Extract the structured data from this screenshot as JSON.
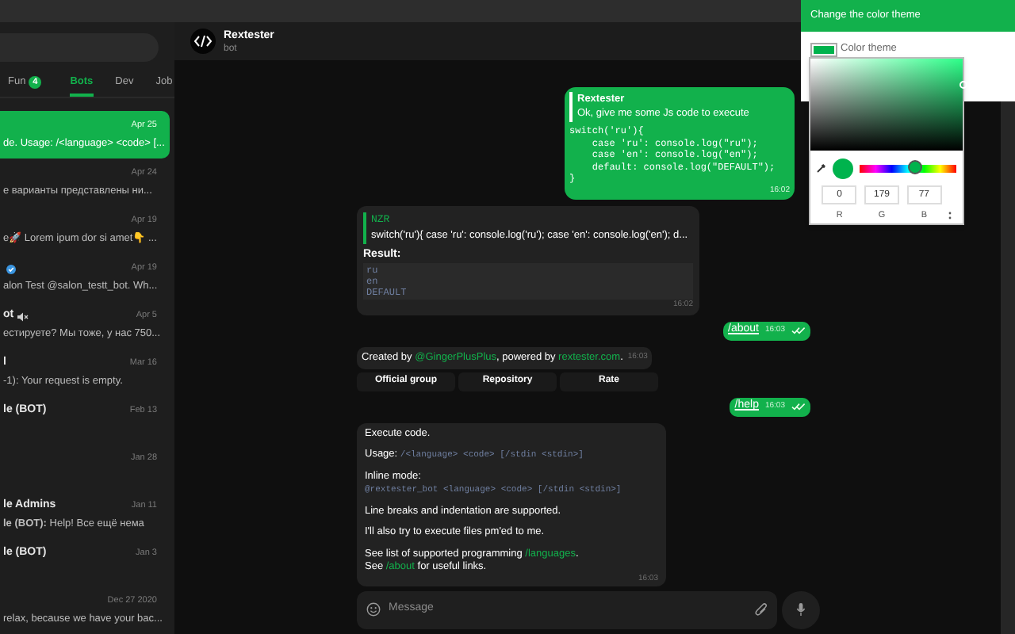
{
  "folders": [
    {
      "label": "Fun",
      "badge": "4",
      "selected": false
    },
    {
      "label": "Bots",
      "selected": true
    },
    {
      "label": "Dev",
      "selected": false
    },
    {
      "label": "Job",
      "selected": false
    }
  ],
  "chats": [
    {
      "date": "Apr 25",
      "preview": "de. Usage: /<language> <code> [...",
      "selected": true
    },
    {
      "date": "Apr 24",
      "preview": "е варианты представлены ни...",
      "selected": false
    },
    {
      "date": "Apr 19",
      "preview": "e🚀 Lorem ipum dor si amet👇 ...",
      "selected": false
    },
    {
      "verified": true,
      "date": "Apr 19",
      "preview": "alon Test @salon_testt_bot. Wh...",
      "selected": false
    },
    {
      "name": "ot",
      "muted": true,
      "date": "Apr 5",
      "preview": "естируете? Мы тоже, у нас 750...",
      "selected": false
    },
    {
      "name": "l",
      "date": "Mar 16",
      "preview": "-1): Your request is empty.",
      "selected": false
    },
    {
      "name": "le (BOT)",
      "date": "Feb 13",
      "selected": false
    },
    {
      "date": "Jan 28",
      "selected": false
    },
    {
      "name": "le Admins",
      "date": "Jan 11",
      "preview": "**le (BOT):** Help! Все ещё нема",
      "selected": false
    },
    {
      "name": "le (BOT)",
      "date": "Jan 3",
      "selected": false
    },
    {
      "date": "Dec 27 2020",
      "preview": "relax, because we have your bac...",
      "selected": false
    }
  ],
  "chat": {
    "title": "Rextester",
    "subtitle": "bot"
  },
  "messages": [
    {
      "kind": "outgoing_code",
      "quote_author": "Rextester",
      "quote_text": "Ok, give me some Js code to execute",
      "code": [
        "switch('ru'){",
        "    case 'ru': console.log(\"ru\");",
        "    case 'en': console.log(\"en\");",
        "    default: console.log(\"DEFAULT\");",
        "}"
      ],
      "time": "16:02"
    },
    {
      "kind": "incoming_result",
      "quote_author": "NZR",
      "quote_text": "switch('ru'){ case 'ru': console.log('ru'); case 'en': console.log('en'); d...",
      "label": "Result:",
      "code": [
        "ru",
        "en",
        "DEFAULT"
      ],
      "time": "16:02"
    },
    {
      "kind": "outgoing_command",
      "text": "/about",
      "time": "16:03"
    },
    {
      "kind": "incoming_info",
      "parts": [
        {
          "kind": "plain",
          "text": "Created by "
        },
        {
          "kind": "link",
          "text": "@GingerPlusPlus"
        },
        {
          "kind": "plain",
          "text": ", powered by "
        },
        {
          "kind": "link",
          "text": "rextester.com"
        },
        {
          "kind": "plain",
          "text": "."
        }
      ],
      "time": "16:03",
      "buttons": [
        "Official group",
        "Repository",
        "Rate"
      ]
    },
    {
      "kind": "outgoing_command",
      "text": "/help",
      "time": "16:03"
    },
    {
      "kind": "incoming_help",
      "paragraphs": [
        [
          [
            {
              "kind": "plain",
              "text": "Execute code."
            }
          ]
        ],
        [
          [
            {
              "kind": "plain",
              "text": "Usage: "
            },
            {
              "kind": "code",
              "text": "/<language> <code> [/stdin <stdin>]"
            }
          ]
        ],
        [
          [
            {
              "kind": "plain",
              "text": "Inline mode:"
            }
          ],
          [
            {
              "kind": "code",
              "text": "@rextester_bot <language> <code> [/stdin <stdin>]"
            }
          ]
        ],
        [
          [
            {
              "kind": "plain",
              "text": "Line breaks and indentation are supported."
            }
          ]
        ],
        [
          [
            {
              "kind": "plain",
              "text": "I'll also try to execute files pm'ed to me."
            }
          ]
        ],
        [
          [
            {
              "kind": "plain",
              "text": "See list of supported programming "
            },
            {
              "kind": "link",
              "text": "/languages"
            },
            {
              "kind": "plain",
              "text": "."
            }
          ],
          [
            {
              "kind": "plain",
              "text": "See "
            },
            {
              "kind": "link",
              "text": "/about"
            },
            {
              "kind": "plain",
              "text": " for useful links."
            }
          ]
        ]
      ],
      "time": "16:03"
    }
  ],
  "composer": {
    "placeholder": "Message"
  },
  "theme_panel": {
    "title": "Change the color theme",
    "label": "Color theme",
    "picker": {
      "level": 0.58,
      "channels": [
        {
          "value": "0",
          "label": "R"
        },
        {
          "value": "179",
          "label": "G"
        },
        {
          "value": "77",
          "label": "B"
        }
      ]
    }
  }
}
